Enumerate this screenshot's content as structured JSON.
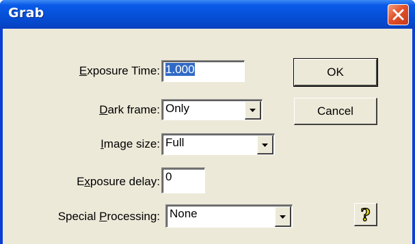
{
  "window": {
    "title": "Grab"
  },
  "form": {
    "exposure_time": {
      "label_mnemonic": "E",
      "label_rest": "xposure Time:",
      "value": "1.000"
    },
    "dark_frame": {
      "label_mnemonic": "D",
      "label_rest": "ark frame:",
      "value": "Only"
    },
    "image_size": {
      "label_mnemonic": "I",
      "label_rest": "mage size:",
      "value": "Full"
    },
    "exposure_delay": {
      "label_pre": "E",
      "label_mnemonic": "x",
      "label_rest": "posure delay:",
      "value": "0"
    },
    "special_processing": {
      "label_pre": "Special ",
      "label_mnemonic": "P",
      "label_rest": "rocessing:",
      "value": "None"
    }
  },
  "buttons": {
    "ok_label": "OK",
    "cancel_label": "Cancel",
    "help_glyph": "?"
  },
  "icons": {
    "close": "close-icon",
    "dropdown": "chevron-down-icon",
    "help": "help-icon"
  },
  "colors": {
    "titlebar": "#0653dc",
    "dialog_face": "#ece9d8",
    "close_button": "#e2512a",
    "selection": "#316ac5",
    "help_question": "#f5e600"
  }
}
